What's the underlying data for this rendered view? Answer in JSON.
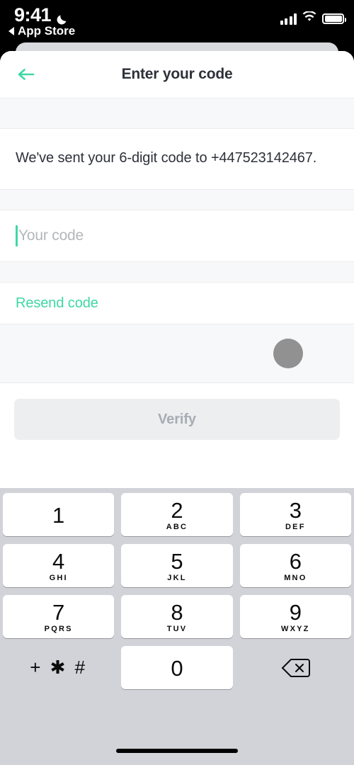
{
  "status_bar": {
    "time": "9:41",
    "dnd_icon": "moon-icon",
    "back_app_label": "App Store",
    "signal_icon": "cellular-signal-icon",
    "wifi_icon": "wifi-icon",
    "battery_icon": "battery-icon"
  },
  "header": {
    "back_icon": "arrow-left-icon",
    "title": "Enter your code"
  },
  "content": {
    "message": "We've sent your 6-digit code to +447523142467.",
    "code_input": {
      "value": "",
      "placeholder": "Your code"
    },
    "resend_label": "Resend code",
    "avatar_icon": "avatar-circle-icon",
    "verify_label": "Verify",
    "verify_enabled": false
  },
  "keyboard": {
    "keys": [
      {
        "digit": "1",
        "letters": ""
      },
      {
        "digit": "2",
        "letters": "ABC"
      },
      {
        "digit": "3",
        "letters": "DEF"
      },
      {
        "digit": "4",
        "letters": "GHI"
      },
      {
        "digit": "5",
        "letters": "JKL"
      },
      {
        "digit": "6",
        "letters": "MNO"
      },
      {
        "digit": "7",
        "letters": "PQRS"
      },
      {
        "digit": "8",
        "letters": "TUV"
      },
      {
        "digit": "9",
        "letters": "WXYZ"
      },
      {
        "digit": "0",
        "letters": ""
      }
    ],
    "symbols_label": "+ ✱ #",
    "backspace_icon": "backspace-icon"
  },
  "colors": {
    "accent": "#3ed8a4",
    "title": "#2d3139",
    "placeholder": "#b3b6bb",
    "disabled_button_bg": "#eceef0",
    "disabled_button_text": "#a8acb3",
    "keyboard_bg": "#d1d3d9",
    "avatar": "#919191"
  }
}
